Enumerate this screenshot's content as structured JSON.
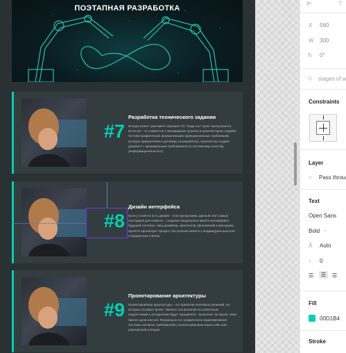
{
  "artboard": {
    "hero_title": "ПОЭТАПНАЯ РАЗРАБОТКА",
    "cards": [
      {
        "number": "#7",
        "title": "Разработка технического задания",
        "text": "Иногда клиент уже имеет хорошее ТЗ. Тогда этот пункт пропускается. Если нет - то совместно с менеджером проекта и архитектором создаём тестово-графическую формализацию функциональных требований, которую прикрепляем к договору на разработку. Архитектор создаёт документ с минимальным требованием по системному качеству (информационального)."
      },
      {
        "number": "#8",
        "title": "Дизайн интерфейса",
        "text": "Если у клиента есть дизайн - этап пропускаем. Данный этап самый наглядный для клиента - создание визуального макета интерфейса будущей системы. Наш дизайнер, архитектор приложений и менеджер проекта организуют процесс построения макета с индивидуальным или стандартным стилем."
      },
      {
        "number": "#9",
        "title": "Проектирование архитектуры",
        "text": "Проектирование архитектуры - это принятие ключевых решений, на которых основан проект. Именно эти решения по клиентным подсистемам и алгоритмам будут определять - выполнит ли проект свои бизнес-цели или нет. Формально это графическое моделирование системы согласно требованиям с использованием языка UML или упрощённой нотации."
      }
    ]
  },
  "panel": {
    "x_label": "X",
    "x_value": "560",
    "w_label": "W",
    "w_value": "300",
    "rotation_value": "0°",
    "component_label": "stages of w",
    "constraints_header": "Constraints",
    "layer_header": "Layer",
    "layer_mode": "Pass through",
    "text_header": "Text",
    "font_family": "Open Sans",
    "font_weight": "Bold",
    "line_height": "Auto",
    "letter_spacing": "0",
    "fill_header": "Fill",
    "fill_hex": "00D1B4",
    "stroke_header": "Stroke"
  },
  "colors": {
    "accent": "#00d1b4",
    "artboard_bg": "#2a3133",
    "card_bg": "#333c3e",
    "selection": "#6b3cf0"
  },
  "icons": [
    "align-left-icon",
    "align-center-icon",
    "align-right-icon",
    "rotation-icon",
    "component-diamond-icon",
    "layer-blend-icon",
    "line-height-icon",
    "letter-spacing-icon",
    "chevron-down-icon"
  ]
}
